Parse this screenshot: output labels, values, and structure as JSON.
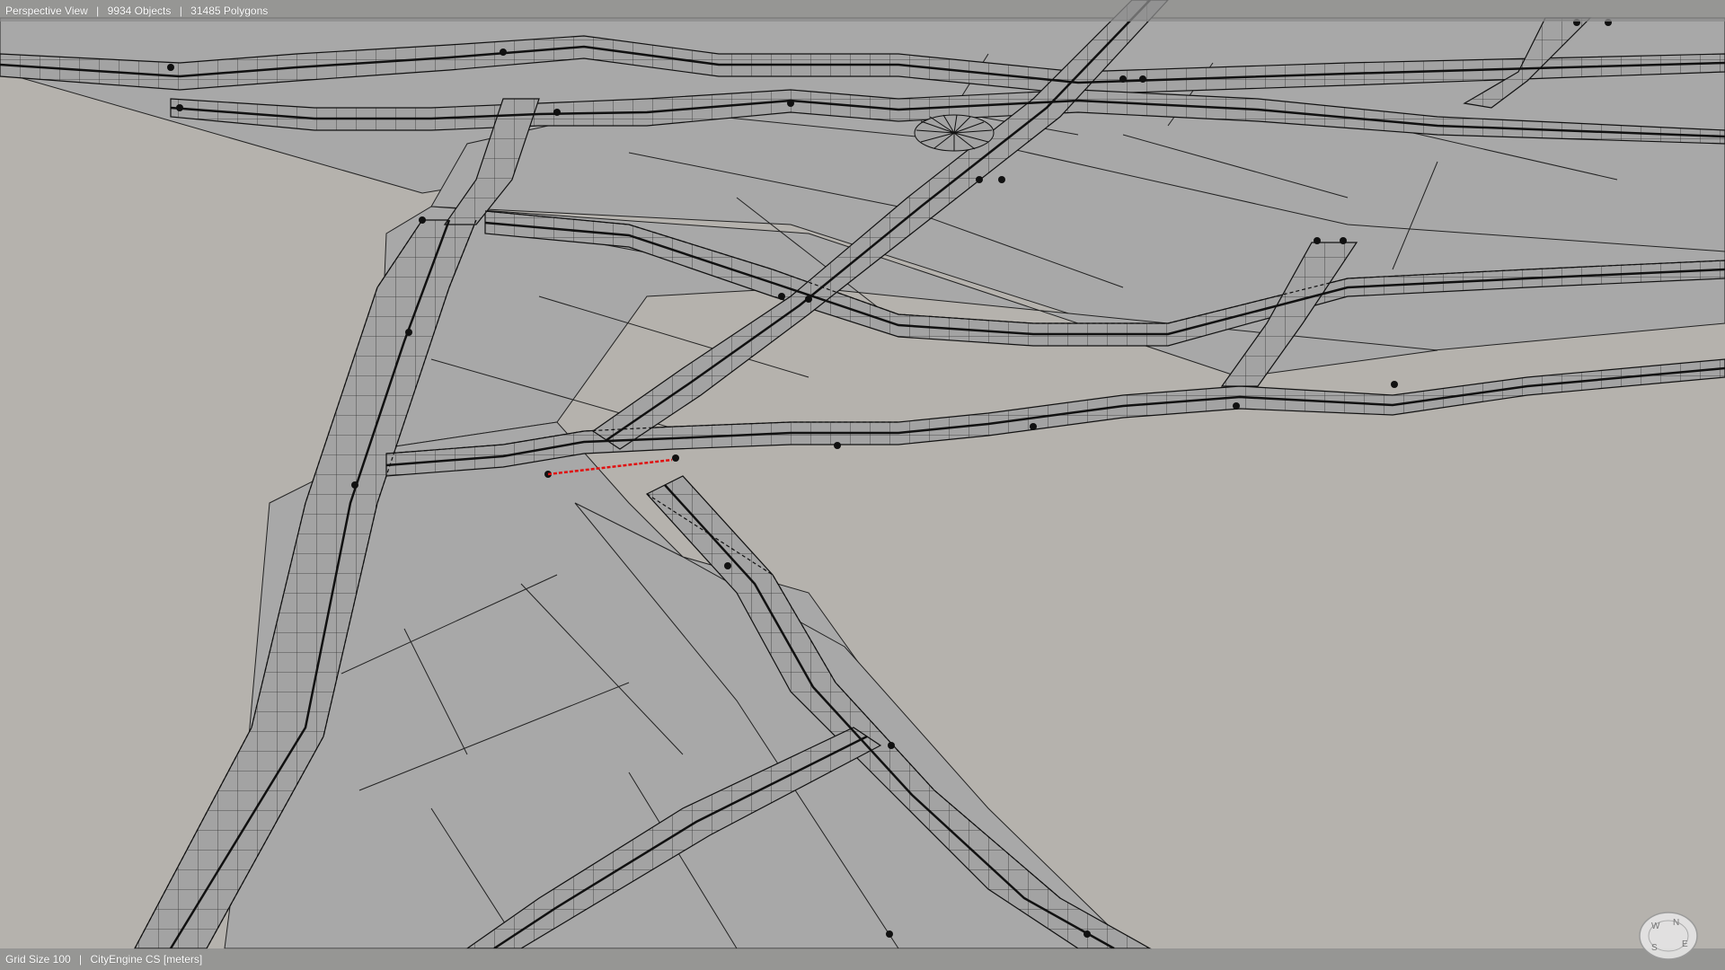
{
  "hud_top": {
    "view_name": "Perspective View",
    "objects": "9934 Objects",
    "polygons": "31485 Polygons",
    "separator": "|"
  },
  "hud_bottom": {
    "grid_size": "Grid Size 100",
    "coord_system": "CityEngine CS [meters]",
    "separator": "|"
  },
  "compass": {
    "n": "N",
    "e": "E",
    "s": "S",
    "w": "W"
  },
  "colors": {
    "ground": "#b5b2ad",
    "block": "#a9a9a9",
    "road": "#9f9f9f",
    "edge": "#111111",
    "selection": "#e01010"
  }
}
